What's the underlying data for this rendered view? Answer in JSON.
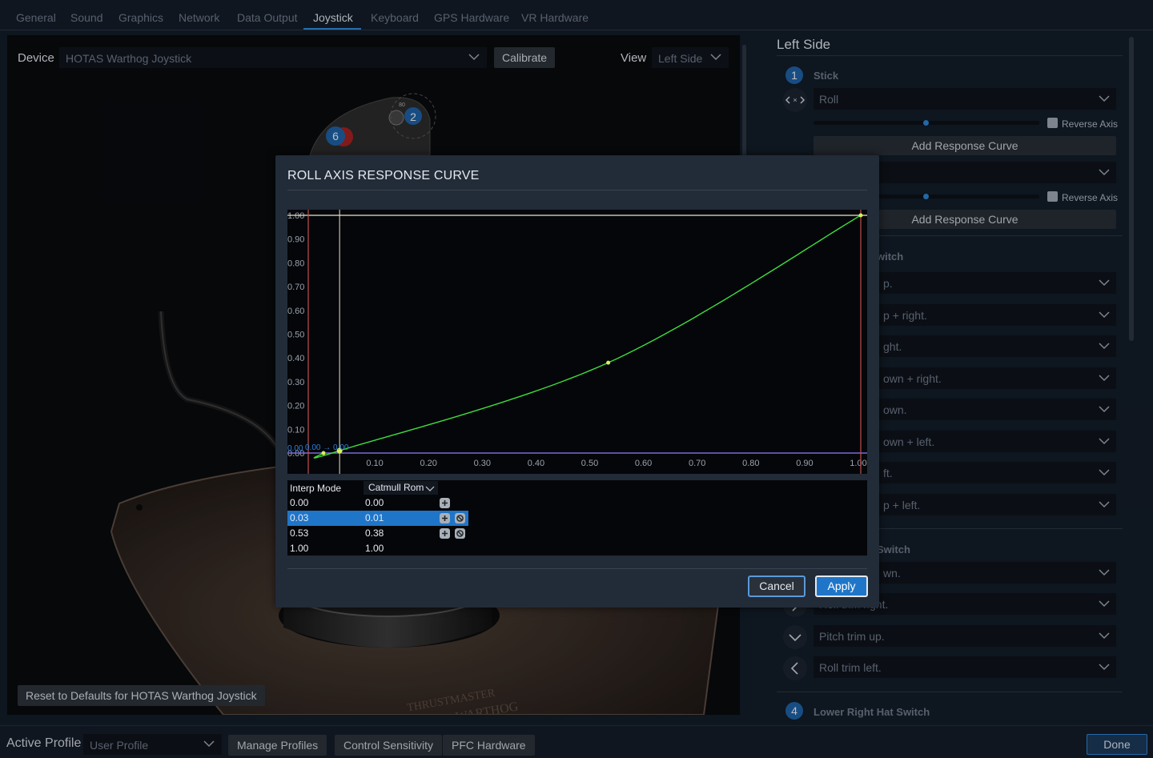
{
  "tabs": [
    {
      "label": "General"
    },
    {
      "label": "Sound"
    },
    {
      "label": "Graphics"
    },
    {
      "label": "Network"
    },
    {
      "label": "Data Output"
    },
    {
      "label": "Joystick"
    },
    {
      "label": "Keyboard"
    },
    {
      "label": "GPS Hardware"
    },
    {
      "label": "VR Hardware"
    }
  ],
  "active_tab": "Joystick",
  "left": {
    "device_label": "Device",
    "device_value": "HOTAS Warthog Joystick",
    "calibrate_label": "Calibrate",
    "view_label": "View",
    "view_value": "Left Side",
    "reset_label": "Reset to Defaults for HOTAS Warthog Joystick",
    "scene_badges": [
      "2",
      "6"
    ],
    "scene_text": {
      "brand": "THRUSTMASTER",
      "model": "WARTHOG",
      "small": "80"
    }
  },
  "right": {
    "title": "Left Side",
    "sections": [
      {
        "number": "1",
        "label": "Stick"
      },
      {
        "number": "4",
        "label": "Lower Right Hat Switch"
      }
    ],
    "partial_section_labels": [
      "witch",
      "Switch"
    ],
    "axis_rows": [
      {
        "value": "Roll",
        "reverse_label": "Reverse Axis",
        "response_label": "Add Response Curve",
        "slider": 0.5
      },
      {
        "value": "",
        "reverse_label": "Reverse Axis",
        "response_label": "Add Response Curve",
        "slider": 0.5
      }
    ],
    "hat1_rows": [
      "p.",
      "p + right.",
      "ght.",
      "own + right.",
      "own.",
      "own + left.",
      "ft.",
      "p + left."
    ],
    "hat2_rows": [
      {
        "value": "wn.",
        "icon": "chevron-down-icon"
      },
      {
        "value": "Roll trim right.",
        "icon": "chevron-right-icon"
      },
      {
        "value": "Pitch trim up.",
        "icon": "chevron-down-icon"
      },
      {
        "value": "Roll trim left.",
        "icon": "chevron-left-icon"
      }
    ]
  },
  "bottom": {
    "active_profile_label": "Active Profile",
    "profile_value": "User Profile",
    "manage_profiles": "Manage Profiles",
    "control_sensitivity": "Control Sensitivity",
    "pfc_hardware": "PFC Hardware",
    "done": "Done"
  },
  "modal": {
    "title": "ROLL AXIS RESPONSE CURVE",
    "cancel": "Cancel",
    "apply": "Apply",
    "point_labels": [
      "0.00",
      "0.00 → 0.00"
    ],
    "table": {
      "interp_mode_label": "Interp Mode",
      "interp_mode_value": "Catmull Rom",
      "rows": [
        {
          "x": "0.00",
          "y": "0.00",
          "add": true,
          "remove": false,
          "selected": false
        },
        {
          "x": "0.03",
          "y": "0.01",
          "add": true,
          "remove": true,
          "selected": true
        },
        {
          "x": "0.53",
          "y": "0.38",
          "add": true,
          "remove": true,
          "selected": false
        },
        {
          "x": "1.00",
          "y": "1.00",
          "add": false,
          "remove": false,
          "selected": false
        }
      ]
    }
  },
  "chart_data": {
    "type": "line",
    "title": "ROLL AXIS RESPONSE CURVE",
    "xlabel": "",
    "ylabel": "",
    "xlim": [
      0,
      1
    ],
    "ylim": [
      0,
      1
    ],
    "x_ticks": [
      "0.10",
      "0.20",
      "0.30",
      "0.40",
      "0.50",
      "0.60",
      "0.70",
      "0.80",
      "0.90",
      "1.00"
    ],
    "y_ticks": [
      "1.00",
      "0.90",
      "0.80",
      "0.70",
      "0.60",
      "0.50",
      "0.40",
      "0.30",
      "0.20",
      "0.10",
      "0.00"
    ],
    "interpolation": "Catmull Rom",
    "control_points": [
      {
        "x": 0.0,
        "y": 0.0
      },
      {
        "x": 0.03,
        "y": 0.01
      },
      {
        "x": 0.53,
        "y": 0.38
      },
      {
        "x": 1.0,
        "y": 1.0
      }
    ],
    "selected_point": 1,
    "colors": {
      "curve": "#3ddc3d",
      "point": "#d8f060",
      "upper_bound": "#e8e6d0",
      "lower_bound": "#7a6ad8",
      "limit_line": "#c05050",
      "cursor_line": "#e8e6d0"
    }
  },
  "colors": {
    "accent": "#2f86d4",
    "background": "#121b27",
    "modal_bg": "#222b38",
    "selected_row": "#1f76c9"
  }
}
